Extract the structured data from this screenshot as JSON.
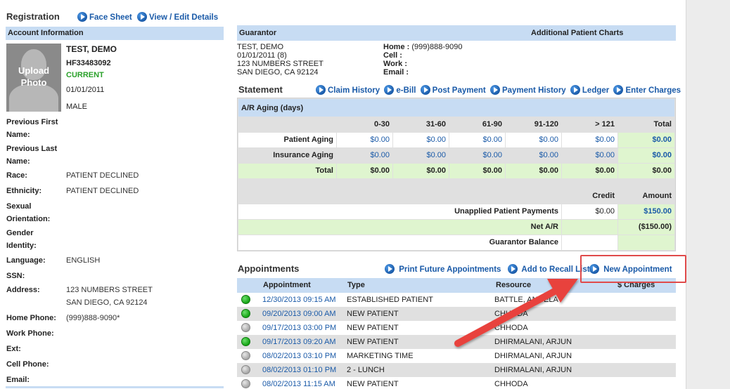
{
  "registration": {
    "title": "Registration",
    "face_sheet": "Face Sheet",
    "view_edit": "View / Edit Details"
  },
  "account": {
    "header": "Account Information",
    "photo_label_1": "Upload",
    "photo_label_2": "Photo",
    "name": "TEST, DEMO",
    "id": "HF33483092",
    "status": "CURRENT",
    "dob": "01/01/2011",
    "sex": "MALE",
    "fields": {
      "prev_first_label_1": "Previous First",
      "prev_first_label_2": "Name:",
      "prev_last_label_1": "Previous Last",
      "prev_last_label_2": "Name:",
      "race_label": "Race:",
      "race_value": "PATIENT DECLINED",
      "ethnicity_label": "Ethnicity:",
      "ethnicity_value": "PATIENT DECLINED",
      "sexual_label_1": "Sexual",
      "sexual_label_2": "Orientation:",
      "gender_label_1": "Gender",
      "gender_label_2": "Identity:",
      "language_label": "Language:",
      "language_value": "ENGLISH",
      "ssn_label": "SSN:",
      "address_label": "Address:",
      "address_line1": "123 NUMBERS STREET",
      "address_line2": "SAN DIEGO, CA 92124",
      "home_phone_label": "Home Phone:",
      "home_phone_value": "(999)888-9090*",
      "work_phone_label": "Work Phone:",
      "ext_label": "Ext:",
      "cell_phone_label": "Cell Phone:",
      "email_label": "Email:"
    }
  },
  "guarantor": {
    "header": "Guarantor",
    "additional": "Additional Patient Charts",
    "name": "TEST, DEMO",
    "dob": "01/01/2011 (8)",
    "street": "123 NUMBERS STREET",
    "city": "SAN DIEGO, CA 92124",
    "home_label": "Home :",
    "home_value": "(999)888-9090",
    "cell_label": "Cell :",
    "work_label": "Work :",
    "email_label": "Email :"
  },
  "statement": {
    "title": "Statement",
    "links": [
      "Claim History",
      "e-Bill",
      "Post Payment",
      "Payment History",
      "Ledger",
      "Enter Charges"
    ],
    "aging_header": "A/R Aging (days)",
    "columns": [
      "0-30",
      "31-60",
      "61-90",
      "91-120",
      "> 121",
      "Total"
    ],
    "patient_aging_label": "Patient Aging",
    "patient_aging": [
      "$0.00",
      "$0.00",
      "$0.00",
      "$0.00",
      "$0.00",
      "$0.00"
    ],
    "insurance_aging_label": "Insurance Aging",
    "insurance_aging": [
      "$0.00",
      "$0.00",
      "$0.00",
      "$0.00",
      "$0.00",
      "$0.00"
    ],
    "total_label": "Total",
    "totals": [
      "$0.00",
      "$0.00",
      "$0.00",
      "$0.00",
      "$0.00",
      "$0.00"
    ],
    "credit_label": "Credit",
    "amount_label": "Amount",
    "unapplied_label": "Unapplied Patient Payments",
    "unapplied_credit": "$0.00",
    "unapplied_amount": "$150.00",
    "net_ar_label": "Net A/R",
    "net_ar_amount": "($150.00)",
    "guarantor_balance_label": "Guarantor Balance"
  },
  "appointments": {
    "title": "Appointments",
    "print_future": "Print Future Appointments",
    "add_recall": "Add to Recall List",
    "new_appointment": "New Appointment",
    "columns": [
      "Appointment",
      "Type",
      "Resource",
      "$ Charges"
    ],
    "rows": [
      {
        "status": "green",
        "datetime": "12/30/2013 09:15 AM",
        "type": "ESTABLISHED PATIENT",
        "resource": "BATTLE, ANGELA"
      },
      {
        "status": "green",
        "datetime": "09/20/2013 09:00 AM",
        "type": "NEW PATIENT",
        "resource": "CHHODA"
      },
      {
        "status": "gray",
        "datetime": "09/17/2013 03:00 PM",
        "type": "NEW PATIENT",
        "resource": "CHHODA"
      },
      {
        "status": "green",
        "datetime": "09/17/2013 09:20 AM",
        "type": "NEW PATIENT",
        "resource": "DHIRMALANI, ARJUN"
      },
      {
        "status": "gray",
        "datetime": "08/02/2013 03:10 PM",
        "type": "MARKETING TIME",
        "resource": "DHIRMALANI, ARJUN"
      },
      {
        "status": "gray",
        "datetime": "08/02/2013 01:10 PM",
        "type": "2 - LUNCH",
        "resource": "DHIRMALANI, ARJUN"
      },
      {
        "status": "gray",
        "datetime": "08/02/2013 11:15 AM",
        "type": "NEW PATIENT",
        "resource": "CHHODA"
      }
    ]
  },
  "colors": {
    "section_header": "#c7dcf3",
    "link": "#1a5aa8",
    "status_current": "#2aa12a",
    "highlight_box": "#e04a4a",
    "arrow": "#e8433d",
    "green_cell": "#dff5cf"
  }
}
